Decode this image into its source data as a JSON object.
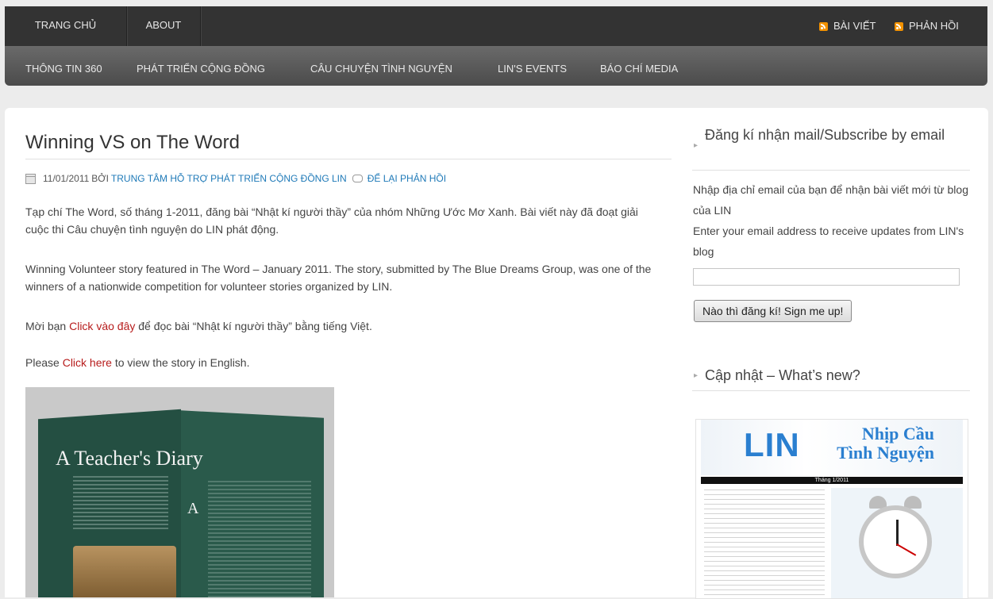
{
  "top_nav": {
    "items": [
      "TRANG CHỦ",
      "ABOUT"
    ],
    "feeds": [
      "BÀI VIẾT",
      "PHẢN HỒI"
    ]
  },
  "sub_nav": {
    "items": [
      "THÔNG TIN 360",
      "PHÁT TRIỂN CỘNG ĐỒNG",
      "CÂU CHUYỆN TÌNH NGUYỆN",
      "LIN'S EVENTS",
      "BÁO CHÍ MEDIA"
    ]
  },
  "post": {
    "title": "Winning VS on The Word",
    "date": "11/01/2011",
    "by": "BỞI",
    "author": "TRUNG TÂM HỖ TRỢ PHÁT TRIỂN CỘNG ĐỒNG LIN",
    "comment_link": "ĐỂ LẠI PHẢN HỒI",
    "para1": "Tạp chí The Word, số tháng 1-2011, đăng bài “Nhật kí người thầy” của nhóm Những Ước Mơ  Xanh. Bài viết này đã đoạt giải cuộc thi Câu chuyện tình nguyện do LIN phát động.",
    "para2": "Winning Volunteer story featured in The Word – January 2011. The story, submitted by The Blue Dreams Group, was one of the winners of a nationwide competition for volunteer stories organized by LIN.",
    "para3_before": "Mời bạn ",
    "para3_link": "Click vào đây",
    "para3_after": " để đọc bài “Nhật kí người thầy” bằng tiếng Việt.",
    "para4_before": "Please ",
    "para4_link": "Click here",
    "para4_after": " to view the story in English.",
    "image_title": "A Teacher's Diary",
    "image_letter": "A"
  },
  "sidebar": {
    "subscribe_title": "Đăng kí nhận mail/Subscribe by email",
    "subscribe_text_vi": "Nhập địa chỉ email của bạn để nhận bài viết mới từ blog của LIN",
    "subscribe_text_en": "Enter your email address to receive updates from LIN's blog",
    "email_value": "",
    "subscribe_button": "Nào thì đăng kí! Sign me up!",
    "whatsnew_title": "Cập nhật – What’s new?",
    "newsletter": {
      "logo": "LIN",
      "tagline_1": "Nhịp Cầu",
      "tagline_2": "Tình Nguyện",
      "month": "Tháng 1/2011"
    }
  }
}
